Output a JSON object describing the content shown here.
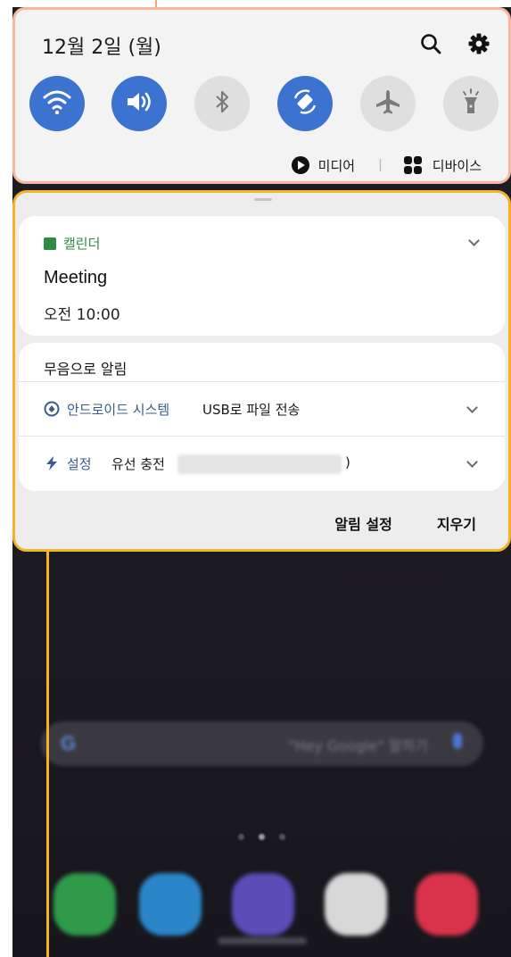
{
  "quick_panel": {
    "date": "12월 2일 (월)",
    "icons": {
      "search": "search-icon",
      "settings": "gear-icon"
    },
    "tiles": [
      {
        "name": "wifi",
        "icon": "wifi-icon",
        "state": "on"
      },
      {
        "name": "sound",
        "icon": "volume-icon",
        "state": "on"
      },
      {
        "name": "bluetooth",
        "icon": "bluetooth-icon",
        "state": "off"
      },
      {
        "name": "auto-rotate",
        "icon": "rotate-icon",
        "state": "on"
      },
      {
        "name": "airplane-mode",
        "icon": "airplane-icon",
        "state": "off"
      },
      {
        "name": "flashlight",
        "icon": "flashlight-icon",
        "state": "off"
      }
    ],
    "media_label": "미디어",
    "devices_label": "디바이스",
    "separator": "|"
  },
  "notifications": {
    "calendar": {
      "app": "캘린더",
      "title": "Meeting",
      "time": "오전 10:00"
    },
    "silent_section": {
      "title": "무음으로 알림",
      "items": [
        {
          "app": "안드로이드 시스템",
          "text": "USB로 파일 전송"
        },
        {
          "app": "설정",
          "text": "유선 충전",
          "suffix": ")"
        }
      ]
    },
    "actions": {
      "settings": "알림 설정",
      "clear": "지우기"
    }
  },
  "home_screen": {
    "search_hint": "\"Hey Google\" 말하기",
    "google_letter": "G"
  },
  "colors": {
    "accent": "#3d73d0",
    "tile_off": "#dfdfdf",
    "calendar_green": "#2f8a45",
    "quick_panel_outline": "#f7b79d",
    "notification_outline": "#f2b52a"
  }
}
